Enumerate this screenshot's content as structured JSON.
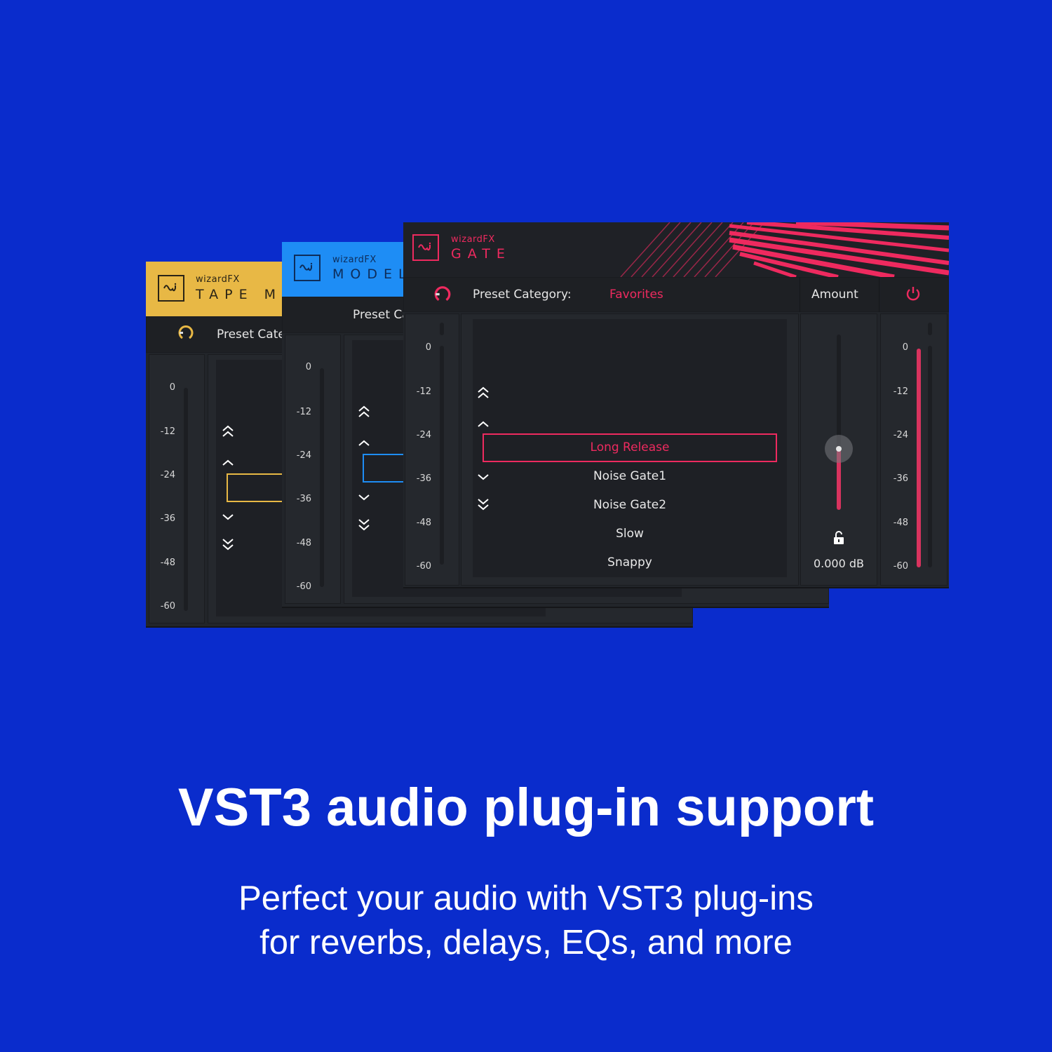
{
  "windows": {
    "tape": {
      "brand": "wizardFX",
      "product": "TAPE M",
      "accent": "#e8b845",
      "preset_label": "Preset Cate",
      "meter_ticks": [
        "0",
        "-12",
        "-24",
        "-36",
        "-48",
        "-60"
      ]
    },
    "model": {
      "brand": "wizardFX",
      "product": "MODEL",
      "accent": "#1e8df5",
      "preset_label": "Preset Ca",
      "meter_ticks": [
        "0",
        "-12",
        "-24",
        "-36",
        "-48",
        "-60"
      ]
    },
    "gate": {
      "brand": "wizardFX",
      "product": "GATE",
      "accent": "#ee2a5f",
      "preset_category_label": "Preset Category:",
      "preset_category_value": "Favorites",
      "amount_label": "Amount",
      "amount_value": "0.000 dB",
      "amount_fraction": 0.35,
      "output_level_fraction": 1.0,
      "meter_ticks": [
        "0",
        "-12",
        "-24",
        "-36",
        "-48",
        "-60"
      ],
      "presets": [
        {
          "name": "Long Release",
          "selected": true
        },
        {
          "name": "Noise Gate1",
          "selected": false
        },
        {
          "name": "Noise Gate2",
          "selected": false
        },
        {
          "name": "Slow",
          "selected": false
        },
        {
          "name": "Snappy",
          "selected": false
        }
      ]
    }
  },
  "icons": {
    "logo": "wave-logo-icon",
    "bypass": "bypass-knob-icon",
    "power": "power-icon",
    "lock": "lock-icon",
    "first": "double-chevron-up-icon",
    "prev": "chevron-up-icon",
    "next": "chevron-down-icon",
    "last": "double-chevron-down-icon"
  },
  "background_color": "#0a2ccc",
  "headline": "VST3 audio plug-in support",
  "subtext_line1": "Perfect your audio with VST3 plug-ins",
  "subtext_line2": "for reverbs, delays, EQs, and more"
}
